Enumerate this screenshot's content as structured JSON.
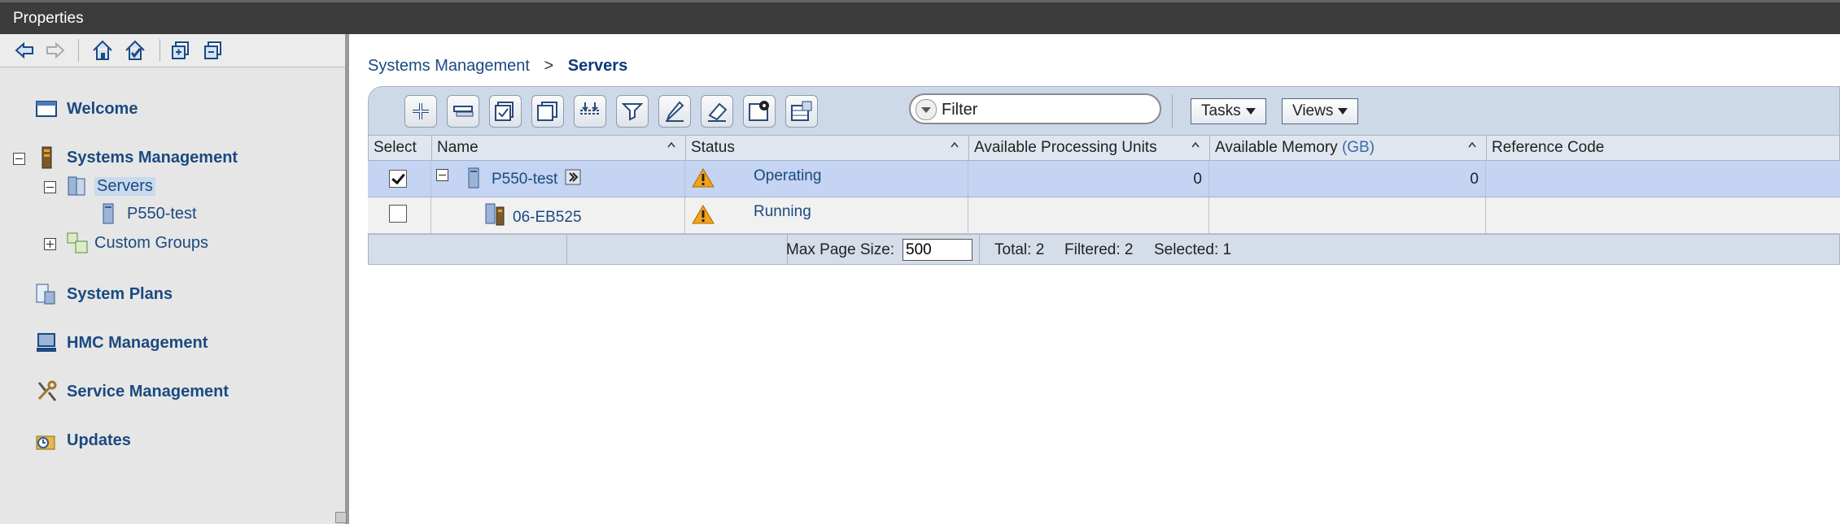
{
  "window": {
    "title": "Properties"
  },
  "nav_toolbar": {
    "icons": [
      "back-arrow-icon",
      "forward-arrow-icon",
      "home-icon",
      "home-check-icon",
      "expand-all-icon",
      "collapse-all-icon"
    ]
  },
  "nav": {
    "welcome": "Welcome",
    "systems_management": "Systems Management",
    "servers": "Servers",
    "server_child": "P550-test",
    "custom_groups": "Custom Groups",
    "system_plans": "System Plans",
    "hmc_management": "HMC Management",
    "service_management": "Service Management",
    "updates": "Updates"
  },
  "breadcrumb": {
    "parent": "Systems Management",
    "separator": ">",
    "current": "Servers"
  },
  "toolbar": {
    "filter_placeholder": "Filter",
    "tasks_label": "Tasks",
    "views_label": "Views"
  },
  "table": {
    "columns": {
      "select": "Select",
      "name": "Name",
      "status": "Status",
      "avail_proc": "Available Processing Units",
      "avail_mem": "Available Memory",
      "avail_mem_unit": "(GB)",
      "ref_code": "Reference Code"
    },
    "rows": [
      {
        "name": "P550-test",
        "status": "Operating",
        "proc": "0",
        "mem": "0",
        "ref": "",
        "selected": true
      },
      {
        "name": "06-EB525",
        "status": "Running",
        "proc": "",
        "mem": "",
        "ref": "",
        "selected": false
      }
    ]
  },
  "footer": {
    "max_page_label": "Max Page Size:",
    "max_page_value": "500",
    "total": "Total: 2",
    "filtered": "Filtered: 2",
    "selected": "Selected: 1"
  },
  "colors": {
    "titlebar": "#3c3c3c",
    "nav_bg": "#e6e6e6",
    "link": "#1a4a80",
    "selected_row": "#c4d4f2"
  }
}
